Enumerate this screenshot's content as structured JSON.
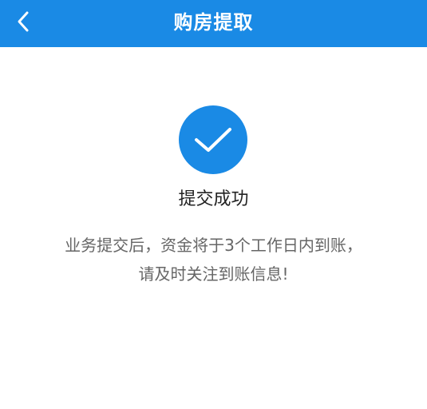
{
  "nav": {
    "title": "购房提取",
    "back_icon": "chevron-left-icon",
    "background_color": "#1a8ae5"
  },
  "result": {
    "icon": "check-icon",
    "title": "提交成功",
    "message_line1": "业务提交后，资金将于3个工作日内到账，",
    "message_line2": "请及时关注到账信息!"
  }
}
